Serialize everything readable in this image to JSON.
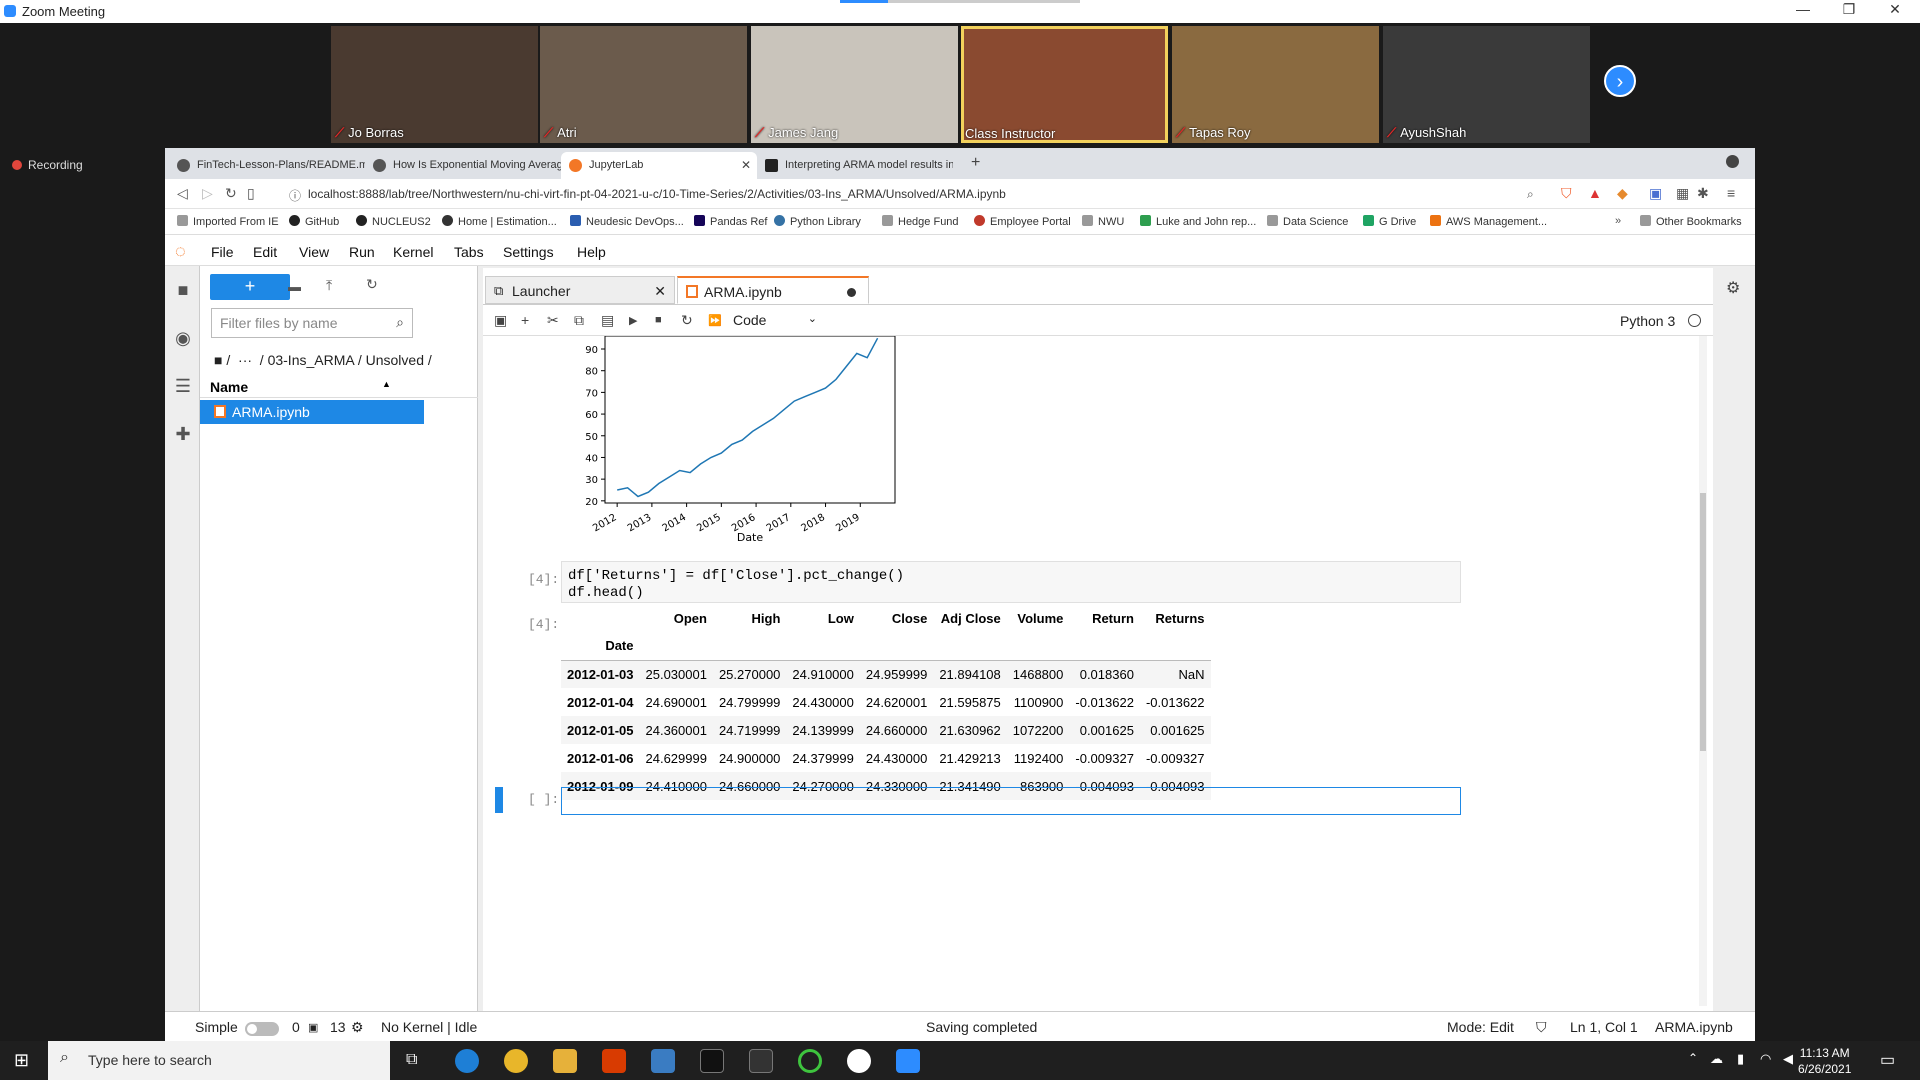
{
  "zoom": {
    "title": "Zoom Meeting",
    "recording": "Recording",
    "participants": [
      {
        "name": "Jo Borras",
        "color": "#4a3a30"
      },
      {
        "name": "Atri",
        "color": "#6b5b4c"
      },
      {
        "name": "James Jang",
        "color": "#c9c4bb"
      },
      {
        "name": "Class Instructor",
        "color": "#8a4a30"
      },
      {
        "name": "Tapas Roy",
        "color": "#8a6a40"
      },
      {
        "name": "AyushShah",
        "color": "#3a3a3a"
      }
    ]
  },
  "browser": {
    "tabs": [
      "FinTech-Lesson-Plans/README.m",
      "How Is Exponential Moving Average",
      "JupyterLab",
      "Interpreting ARMA model results in"
    ],
    "url": "localhost:8888/lab/tree/Northwestern/nu-chi-virt-fin-pt-04-2021-u-c/10-Time-Series/2/Activities/03-Ins_ARMA/Unsolved/ARMA.ipynb",
    "bookmarks": [
      "Imported From IE",
      "GitHub",
      "NUCLEUS2",
      "Home | Estimation...",
      "Neudesic DevOps...",
      "Pandas Ref",
      "Python Library",
      "Hedge Fund",
      "Employee Portal",
      "NWU",
      "Luke and John rep...",
      "Data Science",
      "G Drive",
      "AWS Management..."
    ],
    "other_bookmarks": "Other Bookmarks"
  },
  "jupyter": {
    "menu": [
      "File",
      "Edit",
      "View",
      "Run",
      "Kernel",
      "Tabs",
      "Settings",
      "Help"
    ],
    "filter_placeholder": "Filter files by name",
    "breadcrumb": "/  ···  / 03-Ins_ARMA / Unsolved /",
    "col_name": "Name",
    "file": "ARMA.ipynb",
    "doc_tabs": [
      "Launcher",
      "ARMA.ipynb"
    ],
    "cell_type": "Code",
    "kernel": "Python 3",
    "prompt4": "[4]:",
    "prompt_empty": "[ ]:",
    "code_line1": "df['Returns'] = df['Close'].pct_change()",
    "code_line2": "df.head()",
    "table": {
      "columns": [
        "Open",
        "High",
        "Low",
        "Close",
        "Adj Close",
        "Volume",
        "Return",
        "Returns"
      ],
      "index_name": "Date",
      "rows": [
        [
          "2012-01-03",
          "25.030001",
          "25.270000",
          "24.910000",
          "24.959999",
          "21.894108",
          "1468800",
          "0.018360",
          "NaN"
        ],
        [
          "2012-01-04",
          "24.690001",
          "24.799999",
          "24.430000",
          "24.620001",
          "21.595875",
          "1100900",
          "-0.013622",
          "-0.013622"
        ],
        [
          "2012-01-05",
          "24.360001",
          "24.719999",
          "24.139999",
          "24.660000",
          "21.630962",
          "1072200",
          "0.001625",
          "0.001625"
        ],
        [
          "2012-01-06",
          "24.629999",
          "24.900000",
          "24.379999",
          "24.430000",
          "21.429213",
          "1192400",
          "-0.009327",
          "-0.009327"
        ],
        [
          "2012-01-09",
          "24.410000",
          "24.660000",
          "24.270000",
          "24.330000",
          "21.341490",
          "863900",
          "-0.004093",
          "-0.004093"
        ]
      ]
    },
    "status": {
      "mode": "Simple",
      "n0": "0",
      "n13": "13",
      "kernel": "No Kernel | Idle",
      "saving": "Saving completed",
      "edit": "Mode: Edit",
      "pos": "Ln 1, Col 1",
      "file": "ARMA.ipynb"
    }
  },
  "chart_data": {
    "type": "line",
    "xlabel": "Date",
    "x_ticks": [
      "2012",
      "2013",
      "2014",
      "2015",
      "2016",
      "2017",
      "2018",
      "2019"
    ],
    "y_ticks": [
      20,
      30,
      40,
      50,
      60,
      70,
      80,
      90
    ],
    "ylim": [
      19,
      96
    ],
    "series": [
      {
        "x": [
          2012.0,
          2012.3,
          2012.6,
          2012.9,
          2013.2,
          2013.5,
          2013.8,
          2014.1,
          2014.4,
          2014.7,
          2015.0,
          2015.3,
          2015.6,
          2015.9,
          2016.2,
          2016.5,
          2016.8,
          2017.1,
          2017.4,
          2017.7,
          2018.0,
          2018.3,
          2018.6,
          2018.9,
          2019.2,
          2019.5
        ],
        "values": [
          25,
          26,
          22,
          24,
          28,
          31,
          34,
          33,
          37,
          40,
          42,
          46,
          48,
          52,
          55,
          58,
          62,
          66,
          68,
          70,
          72,
          76,
          82,
          88,
          86,
          95
        ],
        "color": "#1f77b4"
      }
    ]
  },
  "taskbar": {
    "search": "Type here to search",
    "time": "11:13 AM",
    "date": "6/26/2021"
  }
}
